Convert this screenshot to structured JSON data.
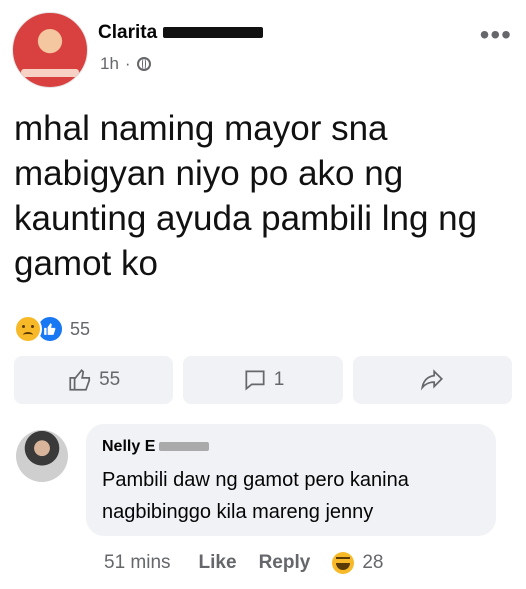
{
  "post": {
    "author_name": "Clarita",
    "time": "1h",
    "separator": "·",
    "more_label": "•••",
    "text": "mhal naming mayor sna mabigyan niyo po ako ng kaunting ayuda pambili lng ng gamot ko",
    "reaction_count": "55",
    "reactions": [
      "sad",
      "like"
    ]
  },
  "actions": {
    "like_count": "55",
    "comment_count": "1"
  },
  "comment": {
    "author_name": "Nelly E",
    "text": "Pambili daw ng gamot pero kanina nagbibinggo kila mareng jenny",
    "time": "51 mins",
    "like_label": "Like",
    "reply_label": "Reply",
    "reaction_count": "28",
    "reaction": "haha"
  }
}
